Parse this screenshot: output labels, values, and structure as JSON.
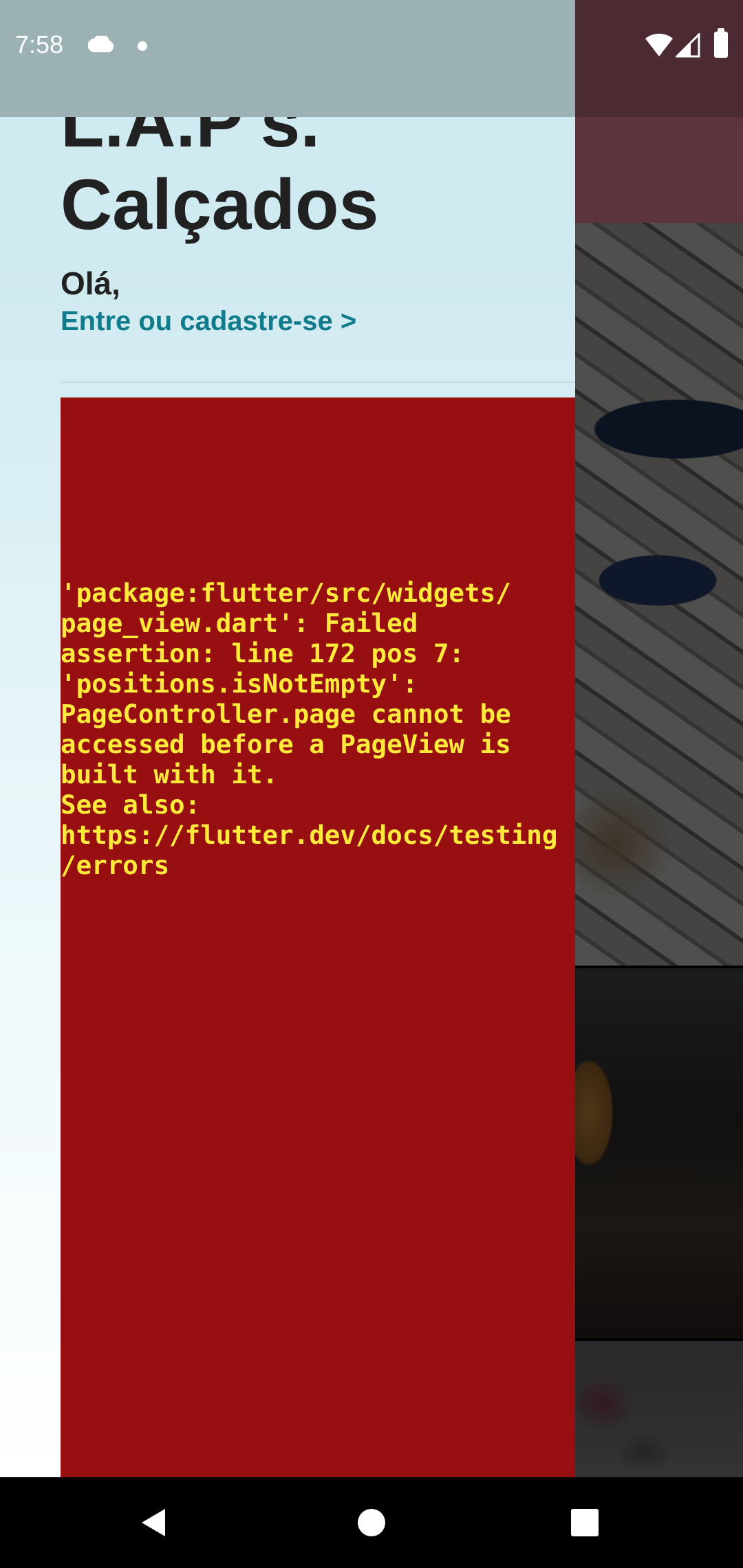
{
  "status_bar": {
    "time": "7:58",
    "icons": [
      "cloud-icon",
      "notification-dot-icon",
      "wifi-icon",
      "signal-icon",
      "battery-icon"
    ]
  },
  "drawer": {
    "title": "L.A.P's. Calçados",
    "greeting": "Olá,",
    "login_link": "Entre ou cadastre-se >"
  },
  "error": {
    "message": "'package:flutter/src/widgets/\npage_view.dart': Failed\nassertion: line 172 pos 7:\n'positions.isNotEmpty':\nPageController.page cannot be\naccessed before a PageView is\nbuilt with it.\nSee also:\nhttps://flutter.dev/docs/testing\n/errors"
  },
  "nav_bar": {
    "icons": [
      "back-icon",
      "home-icon",
      "recents-icon"
    ]
  },
  "colors": {
    "error_background": "#980f11",
    "error_text": "#ffea3c",
    "link": "#0f7b8b",
    "title_text": "#212121",
    "drawer_background": "#cfeaf0"
  }
}
